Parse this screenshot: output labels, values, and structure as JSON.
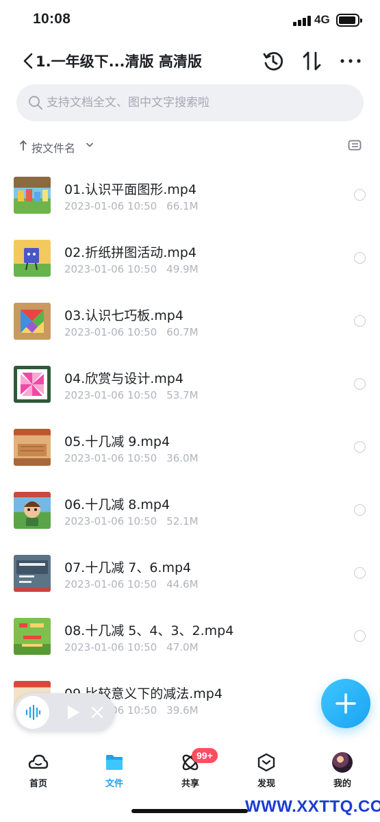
{
  "status_bar": {
    "time": "10:08",
    "network": "4G"
  },
  "nav": {
    "title": "1.一年级下...清版 高清版"
  },
  "search": {
    "placeholder": "支持文档全文、图中文字搜索啦"
  },
  "sort": {
    "label": "按文件名"
  },
  "files": [
    {
      "name": "01.认识平面图形.mp4",
      "date": "2023-01-06 10:50",
      "size": "66.1M"
    },
    {
      "name": "02.折纸拼图活动.mp4",
      "date": "2023-01-06 10:50",
      "size": "49.9M"
    },
    {
      "name": "03.认识七巧板.mp4",
      "date": "2023-01-06 10:50",
      "size": "60.7M"
    },
    {
      "name": "04.欣赏与设计.mp4",
      "date": "2023-01-06 10:50",
      "size": "53.7M"
    },
    {
      "name": "05.十几减 9.mp4",
      "date": "2023-01-06 10:50",
      "size": "36.0M"
    },
    {
      "name": "06.十几减 8.mp4",
      "date": "2023-01-06 10:50",
      "size": "52.1M"
    },
    {
      "name": "07.十几减 7、6.mp4",
      "date": "2023-01-06 10:50",
      "size": "44.6M"
    },
    {
      "name": "08.十几减 5、4、3、2.mp4",
      "date": "2023-01-06 10:50",
      "size": "47.0M"
    },
    {
      "name": "09.比较意义下的减法.mp4",
      "date": "2023-01-06 10:50",
      "size": "39.6M"
    }
  ],
  "tabs": [
    {
      "label": "首页"
    },
    {
      "label": "文件"
    },
    {
      "label": "共享",
      "badge": "99+"
    },
    {
      "label": "发现"
    },
    {
      "label": "我的"
    }
  ],
  "watermark": "WWW.XXTTQ.COM",
  "colors": {
    "accent": "#1ba3f2",
    "badge": "#ff4d5e",
    "meta": "#b0b4bc"
  },
  "icons": [
    "back-icon",
    "history-icon",
    "sort-icon",
    "more-icon",
    "search-icon",
    "view-toggle-icon",
    "voice-icon",
    "play-icon",
    "close-icon",
    "add-icon",
    "home-tab-icon",
    "file-tab-icon",
    "share-tab-icon",
    "discover-tab-icon"
  ]
}
